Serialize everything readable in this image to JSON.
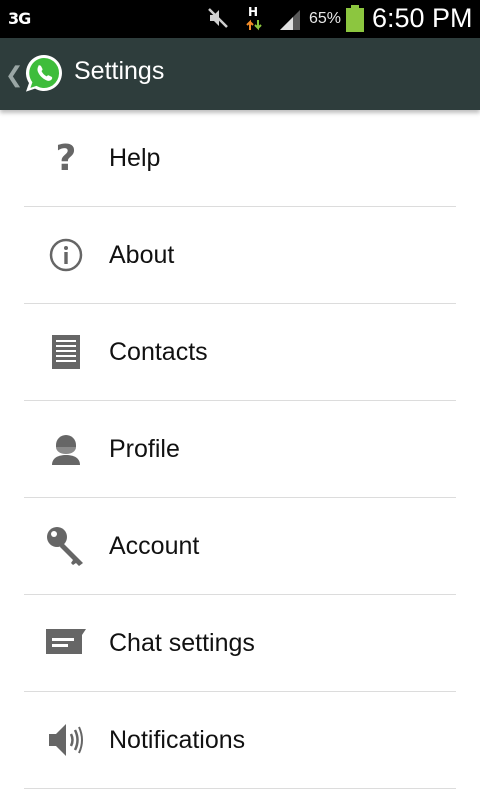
{
  "status_bar": {
    "network": "3G",
    "data_type": "H",
    "battery_percent": "65%",
    "time": "6:50 PM",
    "battery_color": "#8cc63f"
  },
  "action_bar": {
    "title": "Settings",
    "background": "#2e3d3c",
    "back_icon": "chevron-left-icon",
    "logo_icon": "whatsapp-logo-icon"
  },
  "settings": {
    "items": [
      {
        "label": "Help",
        "icon": "question-mark-icon"
      },
      {
        "label": "About",
        "icon": "info-circle-icon"
      },
      {
        "label": "Contacts",
        "icon": "contacts-list-icon"
      },
      {
        "label": "Profile",
        "icon": "person-icon"
      },
      {
        "label": "Account",
        "icon": "key-icon"
      },
      {
        "label": "Chat settings",
        "icon": "chat-bubble-icon"
      },
      {
        "label": "Notifications",
        "icon": "speaker-icon"
      }
    ]
  }
}
